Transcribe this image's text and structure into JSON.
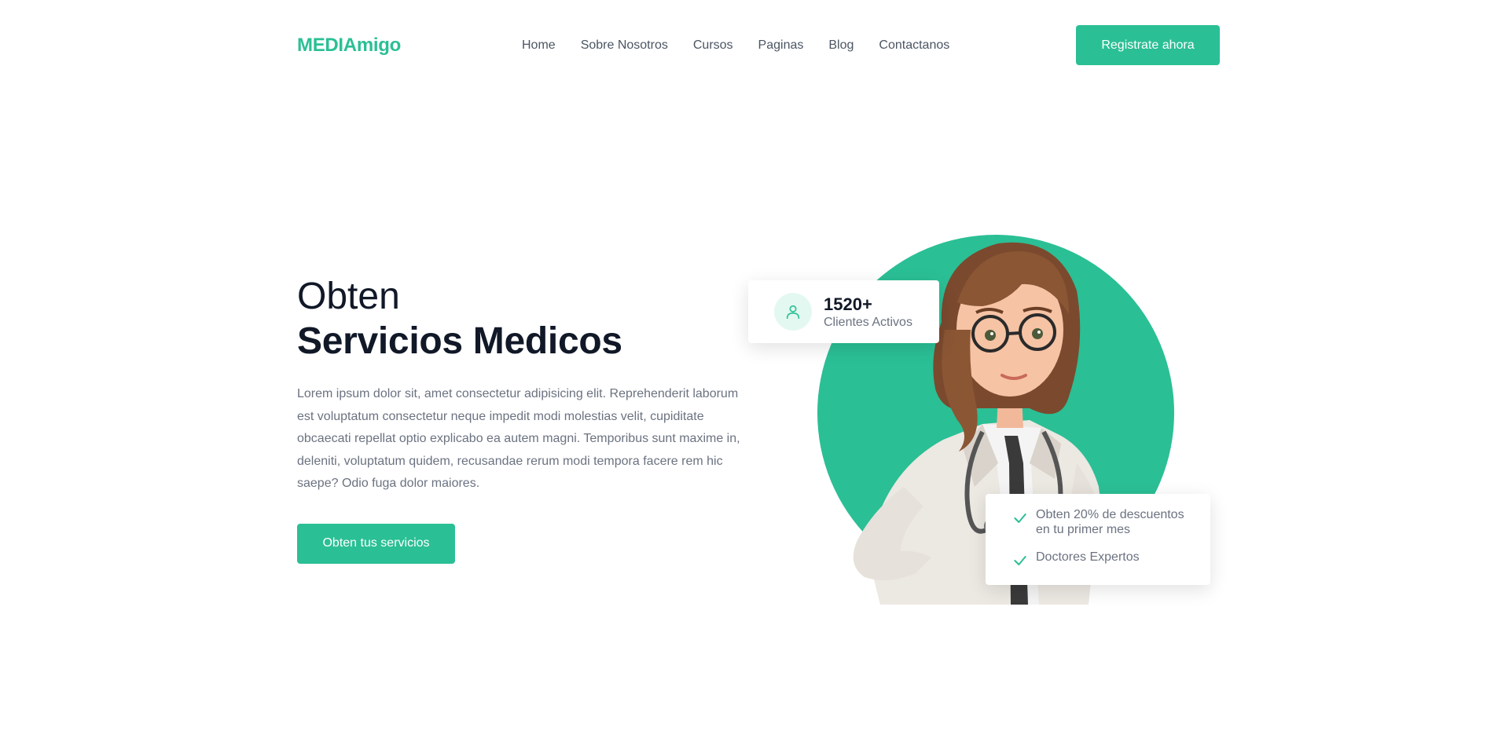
{
  "brand": {
    "logo": "MEDIAmigo",
    "accent": "#2bbf95",
    "text_dark": "#111827",
    "text_muted": "#6b7280"
  },
  "nav": {
    "links": [
      "Home",
      "Sobre Nosotros",
      "Cursos",
      "Paginas",
      "Blog",
      "Contactanos"
    ],
    "cta_label": "Registrate ahora"
  },
  "hero": {
    "line1": "Obten",
    "line2": "Servicios Medicos",
    "description": "Lorem ipsum dolor sit, amet consectetur adipisicing elit. Reprehenderit laborum est voluptatum consectetur neque impedit modi molestias velit, cupiditate obcaecati repellat optio explicabo ea autem magni. Temporibus sunt maxime in, deleniti, voluptatum quidem, recusandae rerum modi tempora facere rem hic saepe? Odio fuga dolor maiores.",
    "cta_label": "Obten tus servicios"
  },
  "stats_card": {
    "icon": "user-icon",
    "number": "1520+",
    "label": "Clientes Activos"
  },
  "features_card": {
    "icon": "check-icon",
    "items": [
      "Obten 20% de descuentos en tu primer mes",
      "Doctores Expertos"
    ]
  },
  "illustration": {
    "subject": "doctor-illustration"
  }
}
